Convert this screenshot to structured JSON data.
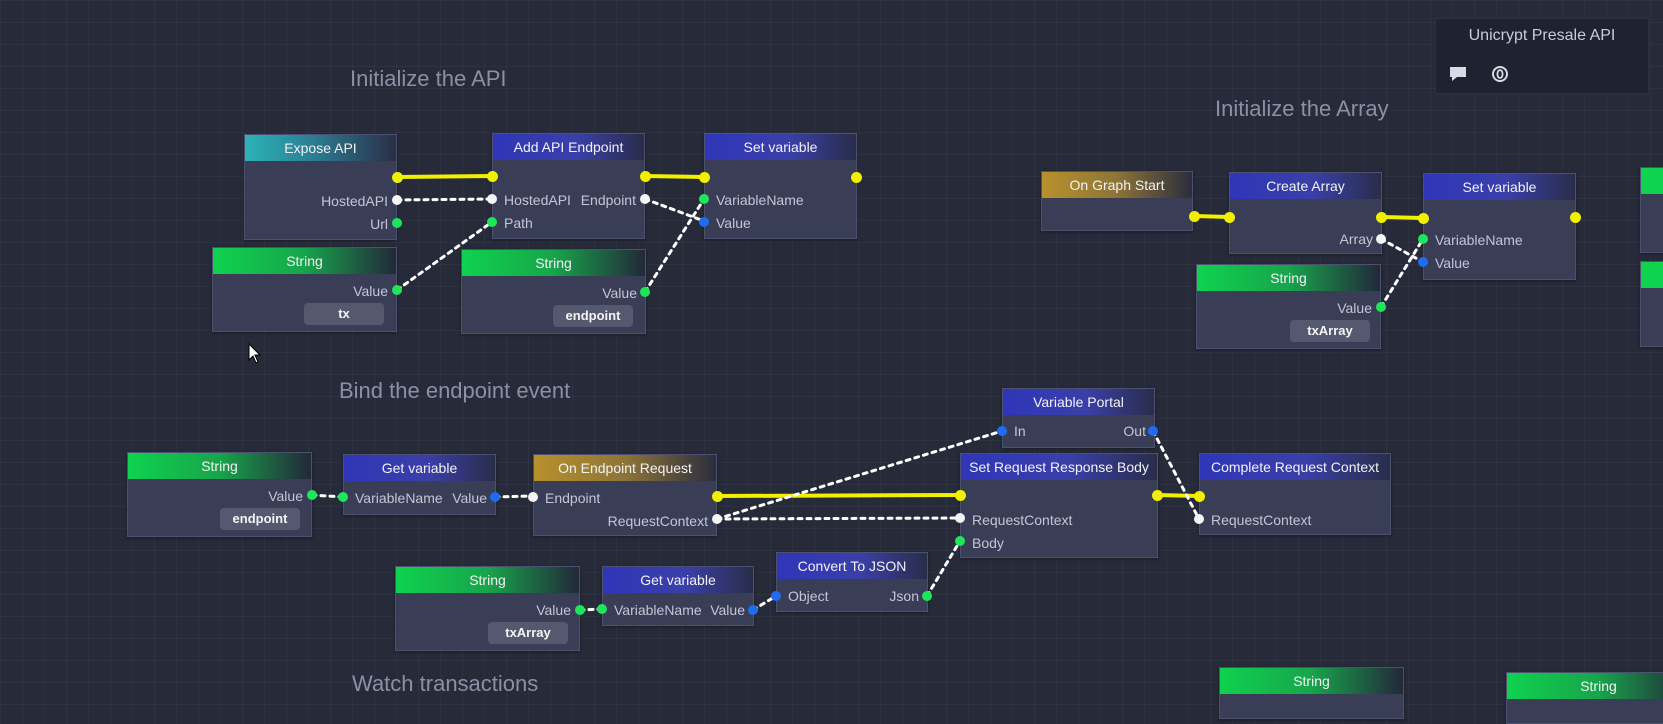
{
  "panel": {
    "title": "Unicrypt Presale API",
    "comment_icon": "comment-icon",
    "badge_icon": "zero-badge-icon"
  },
  "groups": {
    "init_api": "Initialize the API",
    "init_array": "Initialize the Array",
    "bind_event": "Bind the endpoint event",
    "watch_tx": "Watch transactions"
  },
  "nodes": {
    "expose_api": {
      "title": "Expose API",
      "outputs": [
        "HostedAPI",
        "Url"
      ]
    },
    "string_tx": {
      "title": "String",
      "output": "Value",
      "value": "tx"
    },
    "add_endpoint": {
      "title": "Add API Endpoint",
      "inputs": [
        "HostedAPI",
        "Path"
      ],
      "outputs": [
        "Endpoint"
      ]
    },
    "string_endpoint1": {
      "title": "String",
      "output": "Value",
      "value": "endpoint"
    },
    "set_variable1": {
      "title": "Set variable",
      "inputs": [
        "VariableName",
        "Value"
      ]
    },
    "on_graph_start": {
      "title": "On Graph Start"
    },
    "create_array": {
      "title": "Create Array",
      "outputs": [
        "Array"
      ]
    },
    "set_variable2": {
      "title": "Set variable",
      "inputs": [
        "VariableName",
        "Value"
      ]
    },
    "string_txarray1": {
      "title": "String",
      "output": "Value",
      "value": "txArray"
    },
    "string_endpoint2": {
      "title": "String",
      "output": "Value",
      "value": "endpoint"
    },
    "get_variable1": {
      "title": "Get variable",
      "inputs": [
        "VariableName"
      ],
      "outputs": [
        "Value"
      ]
    },
    "on_endpoint_request": {
      "title": "On Endpoint Request",
      "inputs": [
        "Endpoint"
      ],
      "outputs": [
        "RequestContext"
      ]
    },
    "variable_portal": {
      "title": "Variable Portal",
      "inputs": [
        "In"
      ],
      "outputs": [
        "Out"
      ]
    },
    "set_response_body": {
      "title": "Set Request Response Body",
      "inputs": [
        "RequestContext",
        "Body"
      ]
    },
    "complete_request": {
      "title": "Complete Request Context",
      "inputs": [
        "RequestContext"
      ]
    },
    "string_txarray2": {
      "title": "String",
      "output": "Value",
      "value": "txArray"
    },
    "get_variable2": {
      "title": "Get variable",
      "inputs": [
        "VariableName"
      ],
      "outputs": [
        "Value"
      ]
    },
    "convert_json": {
      "title": "Convert To JSON",
      "inputs": [
        "Object"
      ],
      "outputs": [
        "Json"
      ]
    },
    "string_bottom1": {
      "title": "String"
    },
    "string_bottom2": {
      "title": "String"
    }
  },
  "colors": {
    "background": "#262a39",
    "node_body": "#3a3d56",
    "exec_wire": "#f0f000",
    "string_pin": "#1ee65a",
    "object_pin": "#1f6cf0",
    "ref_pin": "#f5f5f5"
  }
}
